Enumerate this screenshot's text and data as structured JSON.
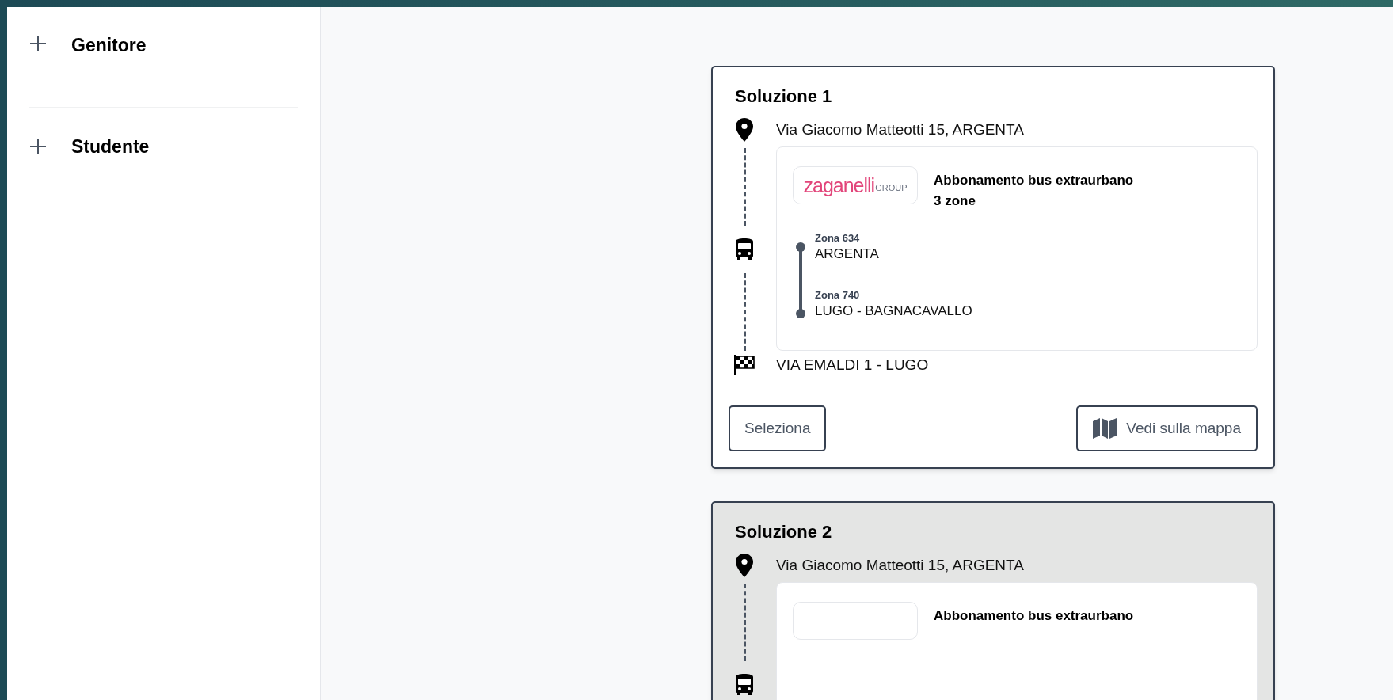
{
  "sidebar": {
    "items": [
      {
        "label": "Genitore",
        "expanded": false
      },
      {
        "label": "Studente",
        "expanded": false
      }
    ]
  },
  "solutions": [
    {
      "title": "Soluzione 1",
      "selected": false,
      "start": "Via Giacomo Matteotti 15, ARGENTA",
      "ticket": {
        "logo": {
          "name": "zaganelli",
          "suffix": "GROUP"
        },
        "title": "Abbonamento bus extraurbano",
        "zones_count": "3 zone",
        "zones": [
          {
            "code": "Zona 634",
            "name": "ARGENTA"
          },
          {
            "code": "Zona 740",
            "name": "LUGO - BAGNACAVALLO"
          }
        ]
      },
      "end": "VIA EMALDI 1 - LUGO",
      "buttons": [
        {
          "kind": "select",
          "label": "Seleziona"
        },
        {
          "kind": "map",
          "label": "Vedi sulla mappa"
        }
      ]
    },
    {
      "title": "Soluzione 2",
      "selected": true,
      "start": "Via Giacomo Matteotti 15, ARGENTA",
      "ticket": {
        "title": "Abbonamento bus extraurbano"
      }
    }
  ]
}
